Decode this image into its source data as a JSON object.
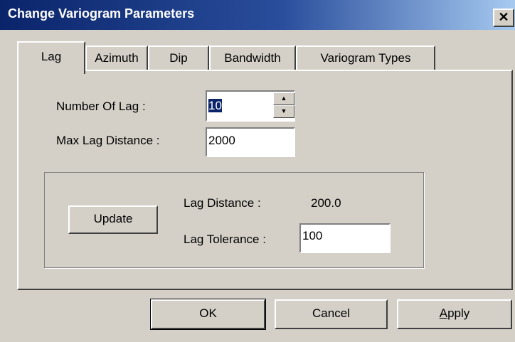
{
  "window": {
    "title": "Change Variogram Parameters",
    "close_glyph": "✕"
  },
  "tabs": [
    {
      "label": "Lag",
      "active": true
    },
    {
      "label": "Azimuth",
      "active": false
    },
    {
      "label": "Dip",
      "active": false
    },
    {
      "label": "Bandwidth",
      "active": false
    },
    {
      "label": "Variogram Types",
      "active": false
    }
  ],
  "lag_tab": {
    "number_of_lag_label": "Number Of Lag :",
    "number_of_lag_value": "10",
    "max_lag_distance_label": "Max Lag Distance :",
    "max_lag_distance_value": "2000",
    "update_button": "Update",
    "lag_distance_label": "Lag Distance :",
    "lag_distance_value": "200.0",
    "lag_tolerance_label": "Lag Tolerance :",
    "lag_tolerance_value": "100"
  },
  "footer": {
    "ok_label": "OK",
    "cancel_label": "Cancel",
    "apply_label_mnemonic": "A",
    "apply_label_rest": "pply"
  },
  "icons": {
    "spin_up": "▲",
    "spin_down": "▼"
  },
  "colors": {
    "title_bar_start": "#0a246a",
    "title_bar_end": "#a6caf0",
    "dialog_face": "#d4d0c8",
    "selection": "#0a246a"
  }
}
